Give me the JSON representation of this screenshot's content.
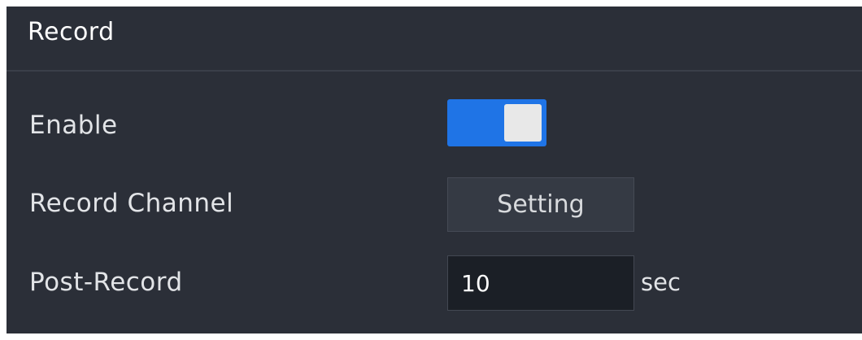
{
  "panel": {
    "title": "Record"
  },
  "enable": {
    "label": "Enable",
    "value": true,
    "accent_color": "#1f74e6"
  },
  "record_channel": {
    "label": "Record Channel",
    "button_label": "Setting"
  },
  "post_record": {
    "label": "Post-Record",
    "value": "10",
    "unit": "sec"
  }
}
